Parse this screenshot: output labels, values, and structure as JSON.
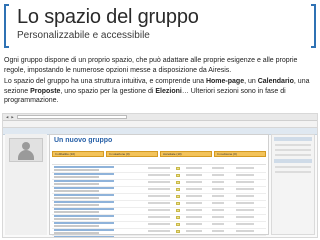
{
  "header": {
    "title": "Lo spazio del gruppo",
    "subtitle": "Personalizzabile e accessibile"
  },
  "body": {
    "paragraph1": "Ogni gruppo dispone di un proprio spazio, che può adattare alle proprie esigenze e alle proprie regole, impostando le numerose opzioni messe a disposizione da Airesis.",
    "p2_a": "Lo spazio del gruppo ha una struttura intuitiva, e comprende una ",
    "p2_home": "Home-page",
    "p2_b": ", un ",
    "p2_cal": "Calendario",
    "p2_c": ", una sezione ",
    "p2_prop": "Proposte",
    "p2_d": ", uno spazio per la gestione di ",
    "p2_elez": "Elezioni",
    "p2_e": "… Ulteriori sezioni sono in fase di programmazione."
  },
  "screenshot": {
    "group_title": "Un nuovo gruppo",
    "tabs": [
      "In dibattito (10)",
      "In votazione (0)",
      "Accettate (10)",
      "In revisione (0)"
    ],
    "colors": {
      "accent": "#2f72b4",
      "tab": "#f3c35a"
    }
  }
}
